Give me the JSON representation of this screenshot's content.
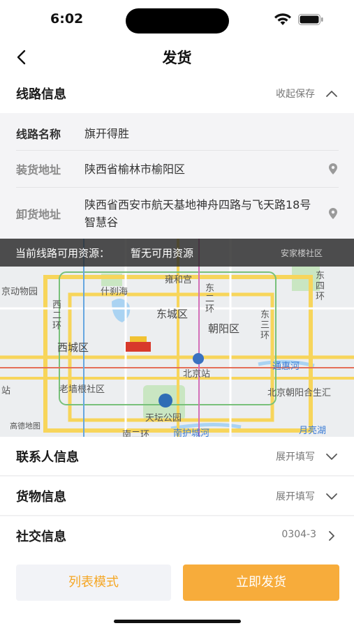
{
  "status_bar": {
    "time": "6:02"
  },
  "nav": {
    "title": "发货"
  },
  "route_section": {
    "title": "线路信息",
    "action": "收起保存",
    "rows": [
      {
        "label": "线路名称",
        "value": "旗开得胜"
      },
      {
        "label": "装货地址",
        "value": "陕西省榆林市榆阳区"
      },
      {
        "label": "卸货地址",
        "value": "陕西省西安市航天基地神舟四路与飞天路18号智慧谷"
      }
    ]
  },
  "map": {
    "resource_label": "当前线路可用资源：",
    "resource_value": "暂无可用资源",
    "places": [
      "安家楼社区",
      "京动物园",
      "什刹海",
      "雍和宫",
      "东二环",
      "东四环",
      "西二环",
      "东城区",
      "朝阳区",
      "东三环",
      "西城区",
      "通惠河",
      "北京站",
      "老墙根社区",
      "北京朝阳合生汇",
      "天坛公园",
      "南二环",
      "南护城河",
      "月亮湖",
      "站"
    ],
    "provider": "高德地图"
  },
  "contact_section": {
    "title": "联系人信息",
    "action": "展开填写"
  },
  "goods_section": {
    "title": "货物信息",
    "action": "展开填写"
  },
  "social_section": {
    "title": "社交信息",
    "value": "0304-3"
  },
  "buttons": {
    "list_mode": "列表模式",
    "ship_now": "立即发货"
  },
  "colors": {
    "accent": "#f7ac3b",
    "accent_text": "#f5a623"
  },
  "icons": [
    "back-icon",
    "wifi-icon",
    "battery-icon",
    "chevron-up-icon",
    "chevron-down-icon",
    "chevron-right-icon",
    "location-pin-icon"
  ]
}
